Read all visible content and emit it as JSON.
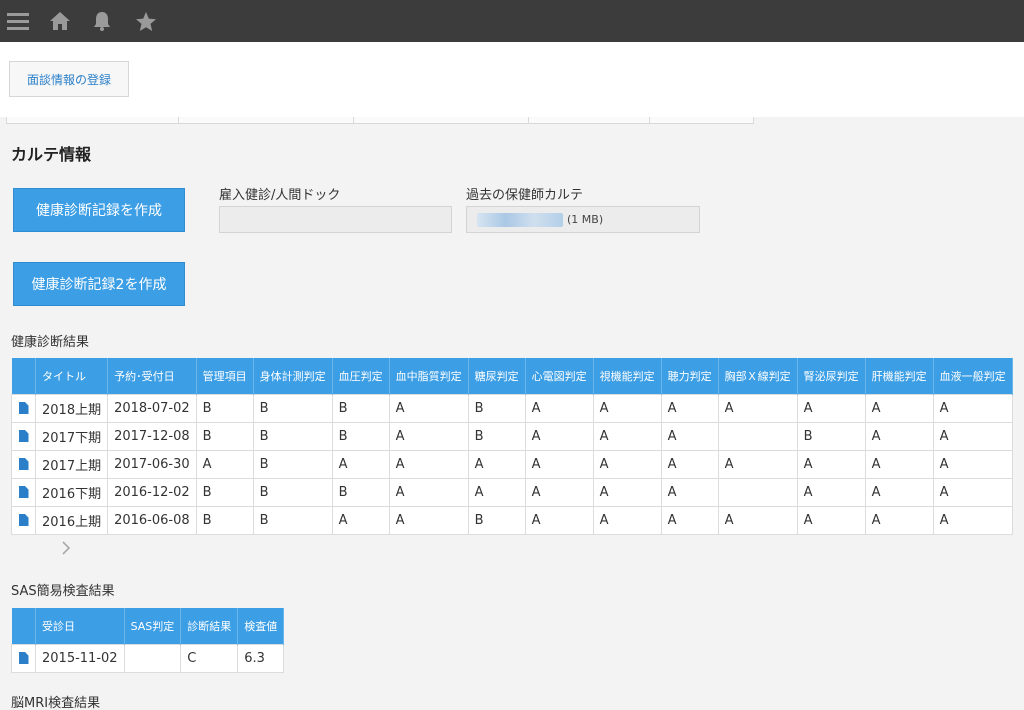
{
  "topbar": {
    "icons": [
      "menu-icon",
      "home-icon",
      "bell-icon",
      "star-icon"
    ]
  },
  "actions": {
    "register_interview": "面談情報の登録"
  },
  "section_title": "カルテ情報",
  "buttons": {
    "create_record": "健康診断記録を作成",
    "create_record2": "健康診断記録2を作成"
  },
  "fields": {
    "dock": {
      "label": "雇入健診/人間ドック",
      "value": ""
    },
    "past_chart": {
      "label": "過去の保健師カルテ",
      "file_size": "(1 MB)"
    }
  },
  "health_results": {
    "label": "健康診断結果",
    "columns": [
      "タイトル",
      "予約･受付日",
      "管理項目",
      "身体計測判定",
      "血圧判定",
      "血中脂質判定",
      "糖尿判定",
      "心電図判定",
      "視機能判定",
      "聴力判定",
      "胸部Ｘ線判定",
      "腎泌尿判定",
      "肝機能判定",
      "血液一般判定"
    ],
    "rows": [
      [
        "2018上期",
        "2018-07-02",
        "B",
        "B",
        "B",
        "A",
        "B",
        "A",
        "A",
        "A",
        "A",
        "A",
        "A",
        "A"
      ],
      [
        "2017下期",
        "2017-12-08",
        "B",
        "B",
        "B",
        "A",
        "B",
        "A",
        "A",
        "A",
        "",
        "B",
        "A",
        "A"
      ],
      [
        "2017上期",
        "2017-06-30",
        "A",
        "B",
        "A",
        "A",
        "A",
        "A",
        "A",
        "A",
        "A",
        "A",
        "A",
        "A"
      ],
      [
        "2016下期",
        "2016-12-02",
        "B",
        "B",
        "B",
        "A",
        "A",
        "A",
        "A",
        "A",
        "",
        "A",
        "A",
        "A"
      ],
      [
        "2016上期",
        "2016-06-08",
        "B",
        "B",
        "A",
        "A",
        "B",
        "A",
        "A",
        "A",
        "A",
        "A",
        "A",
        "A"
      ]
    ]
  },
  "sas": {
    "label": "SAS簡易検査結果",
    "columns": [
      "受診日",
      "SAS判定",
      "診断結果",
      "検査値"
    ],
    "rows": [
      [
        "2015-11-02",
        "",
        "C",
        "6.3"
      ]
    ]
  },
  "mri": {
    "label": "脳MRI検査結果"
  },
  "colors": {
    "accent": "#3c9ee5",
    "topbar": "#3c3c3c",
    "link": "#2a7fc8"
  }
}
